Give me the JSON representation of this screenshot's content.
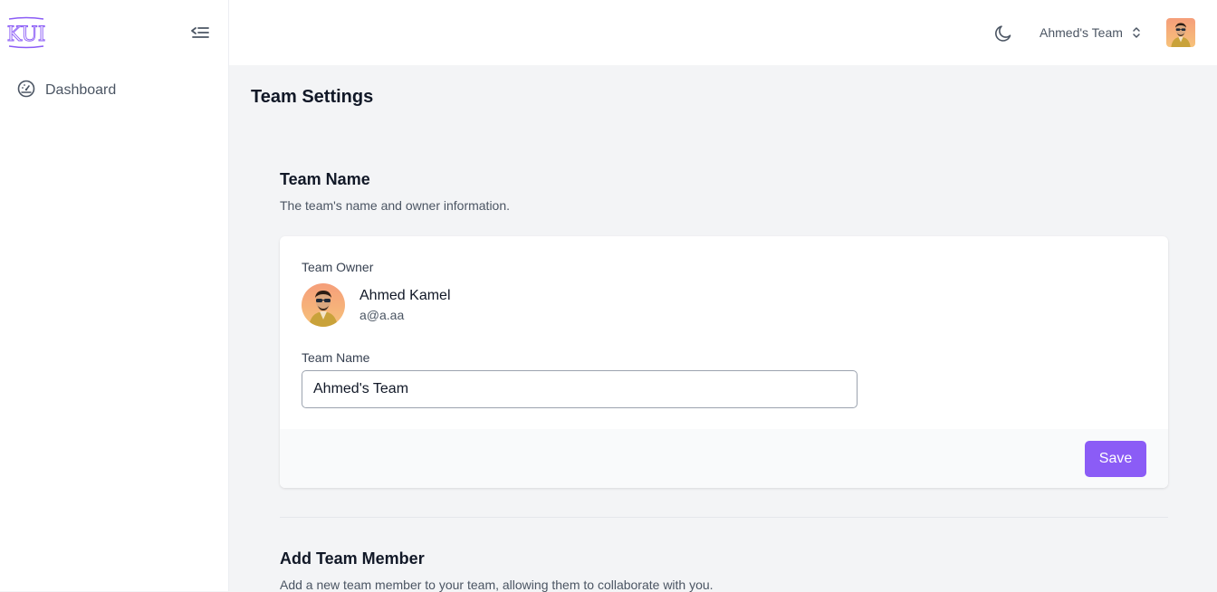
{
  "sidebar": {
    "logo_text": "KUI",
    "items": [
      {
        "label": "Dashboard",
        "icon": "dashboard-gauge-icon"
      }
    ]
  },
  "topbar": {
    "team_switcher_label": "Ahmed's Team"
  },
  "page": {
    "title": "Team Settings"
  },
  "team_name_section": {
    "title": "Team Name",
    "description": "The team's name and owner information.",
    "owner_label": "Team Owner",
    "owner_name": "Ahmed Kamel",
    "owner_email": "a@a.aa",
    "field_label": "Team Name",
    "field_value": "Ahmed's Team",
    "save_label": "Save"
  },
  "add_member_section": {
    "title": "Add Team Member",
    "description": "Add a new team member to your team, allowing them to collaborate with you."
  },
  "colors": {
    "accent": "#8b5cf6",
    "logo": "#8b5cf6",
    "page_background": "#f3f4f6"
  }
}
